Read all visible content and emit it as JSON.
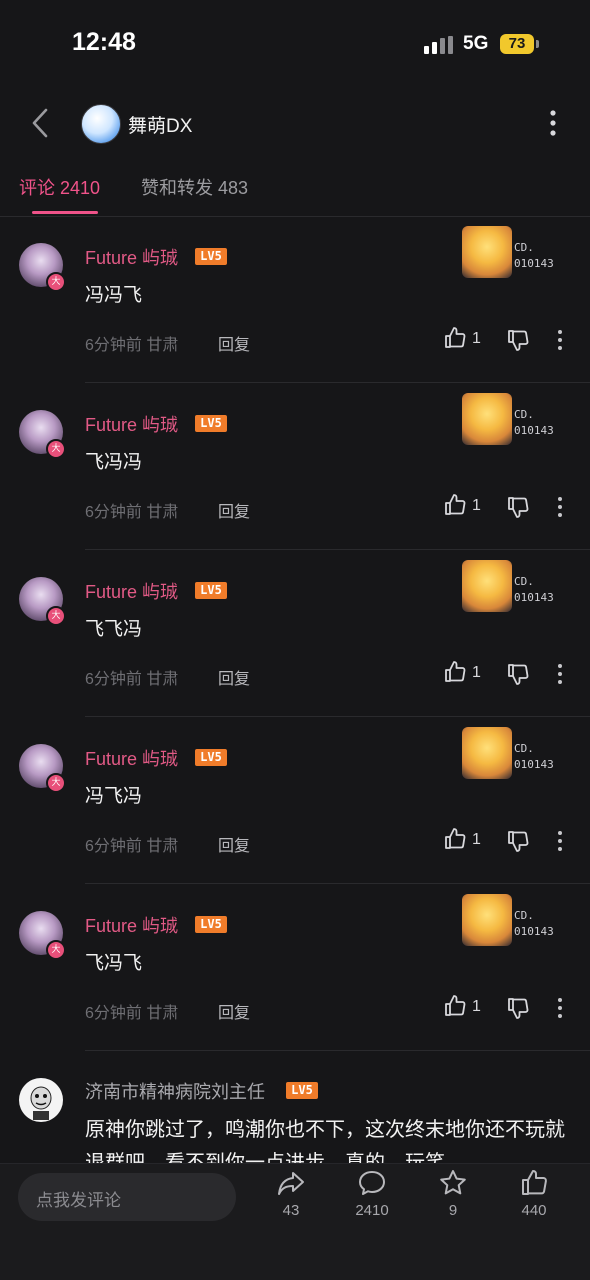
{
  "status_bar": {
    "time": "12:48",
    "network": "5G",
    "battery": "73"
  },
  "header": {
    "title": "舞萌DX"
  },
  "tabs": [
    {
      "label": "评论 2410",
      "active": true
    },
    {
      "label": "赞和转发 483",
      "active": false
    }
  ],
  "comments": [
    {
      "username": "Future 屿珹",
      "level": "LV5",
      "text": "冯冯飞",
      "time": "6分钟前",
      "location": "甘肃",
      "reply": "回复",
      "likes": "1",
      "fan_card": "CD.\n010143"
    },
    {
      "username": "Future 屿珹",
      "level": "LV5",
      "text": "飞冯冯",
      "time": "6分钟前",
      "location": "甘肃",
      "reply": "回复",
      "likes": "1",
      "fan_card": "CD.\n010143"
    },
    {
      "username": "Future 屿珹",
      "level": "LV5",
      "text": "飞飞冯",
      "time": "6分钟前",
      "location": "甘肃",
      "reply": "回复",
      "likes": "1",
      "fan_card": "CD.\n010143"
    },
    {
      "username": "Future 屿珹",
      "level": "LV5",
      "text": "冯飞冯",
      "time": "6分钟前",
      "location": "甘肃",
      "reply": "回复",
      "likes": "1",
      "fan_card": "CD.\n010143"
    },
    {
      "username": "Future 屿珹",
      "level": "LV5",
      "text": "飞冯飞",
      "time": "6分钟前",
      "location": "甘肃",
      "reply": "回复",
      "likes": "1",
      "fan_card": "CD.\n010143"
    }
  ],
  "last_comment": {
    "username": "济南市精神病院刘主任",
    "level": "LV5",
    "text": "原神你跳过了，鸣潮你也不下，这次终末地你还不玩就退群吧，看不到你一点进步，真的，玩笑"
  },
  "bottom_bar": {
    "placeholder": "点我发评论",
    "share_count": "43",
    "comment_count": "2410",
    "favorite_count": "9",
    "like_count": "440"
  },
  "colors": {
    "accent": "#f0538a",
    "username": "#e25a86",
    "level_badge": "#f07c2a",
    "background": "#161618"
  }
}
